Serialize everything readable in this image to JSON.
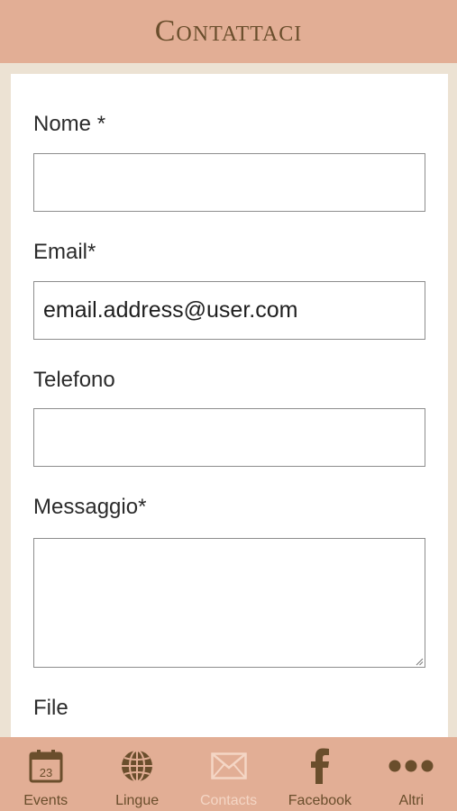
{
  "header": {
    "title": "Contattaci"
  },
  "form": {
    "name_label": "Nome *",
    "name_value": "",
    "email_label": "Email*",
    "email_value": "email.address@user.com",
    "phone_label": "Telefono",
    "phone_value": "",
    "message_label": "Messaggio*",
    "message_value": "",
    "file_label": "File"
  },
  "tabbar": {
    "active": "contacts",
    "colors": {
      "icon": "#6a4e2c",
      "active_icon": "#f4d6c5",
      "background": "#e2ae95"
    },
    "tabs": [
      {
        "label": "Events",
        "icon": "calendar-icon",
        "calendar_day": "23"
      },
      {
        "label": "Lingue",
        "icon": "globe-icon"
      },
      {
        "label": "Contacts",
        "icon": "envelope-icon"
      },
      {
        "label": "Facebook",
        "icon": "facebook-icon"
      },
      {
        "label": "Altri",
        "icon": "more-icon"
      }
    ]
  }
}
